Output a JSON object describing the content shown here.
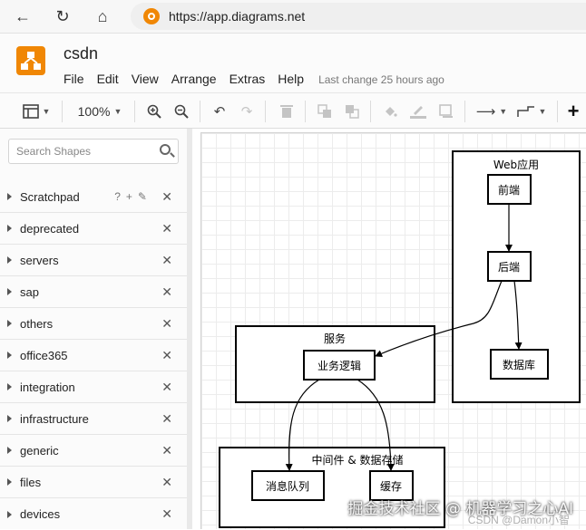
{
  "browser": {
    "url": "https://app.diagrams.net"
  },
  "app": {
    "title": "csdn",
    "menu": [
      "File",
      "Edit",
      "View",
      "Arrange",
      "Extras",
      "Help"
    ],
    "last_change": "Last change 25 hours ago"
  },
  "toolbar": {
    "zoom": "100%"
  },
  "sidebar": {
    "search_placeholder": "Search Shapes",
    "libraries": [
      "Scratchpad",
      "deprecated",
      "servers",
      "sap",
      "others",
      "office365",
      "integration",
      "infrastructure",
      "generic",
      "files",
      "devices"
    ]
  },
  "diagram": {
    "groups": {
      "web": "Web应用",
      "service": "服务",
      "middleware": "中间件 & 数据存储"
    },
    "nodes": {
      "frontend": "前端",
      "backend": "后端",
      "database": "数据库",
      "logic": "业务逻辑",
      "mq": "消息队列",
      "cache": "缓存"
    }
  },
  "watermark": {
    "main": "掘金技术社区 @ 机器学习之心AI",
    "sub": "CSDN @Damon小智"
  }
}
